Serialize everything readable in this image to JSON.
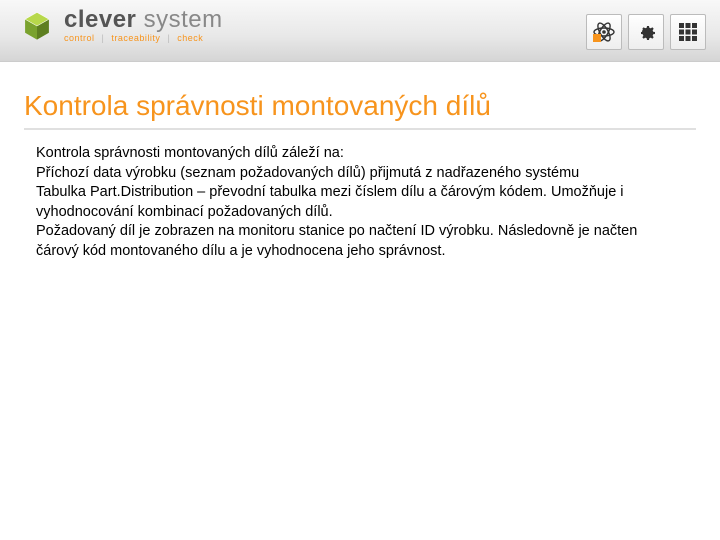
{
  "header": {
    "logo": {
      "brand_bold": "clever",
      "brand_light": " system",
      "tag_control": "control",
      "tag_trace": "traceability",
      "tag_check": "check",
      "tag_sep": "|"
    },
    "icons": {
      "atom": "atom-icon",
      "gear": "gear-icon",
      "grid": "grid-icon"
    }
  },
  "title": "Kontrola správnosti montovaných dílů",
  "body": {
    "p1": "Kontrola správnosti montovaných dílů záleží na:",
    "p2": "Příchozí data výrobku (seznam požadovaných dílů) přijmutá z nadřazeného systému",
    "p3": "Tabulka Part.Distribution – převodní tabulka mezi číslem dílu a čárovým kódem. Umožňuje i vyhodnocování kombinací požadovaných dílů.",
    "p4": "Požadovaný díl je zobrazen na monitoru stanice po načtení ID výrobku. Následovně je načten čárový kód montovaného dílu a je vyhodnocena jeho správnost."
  }
}
